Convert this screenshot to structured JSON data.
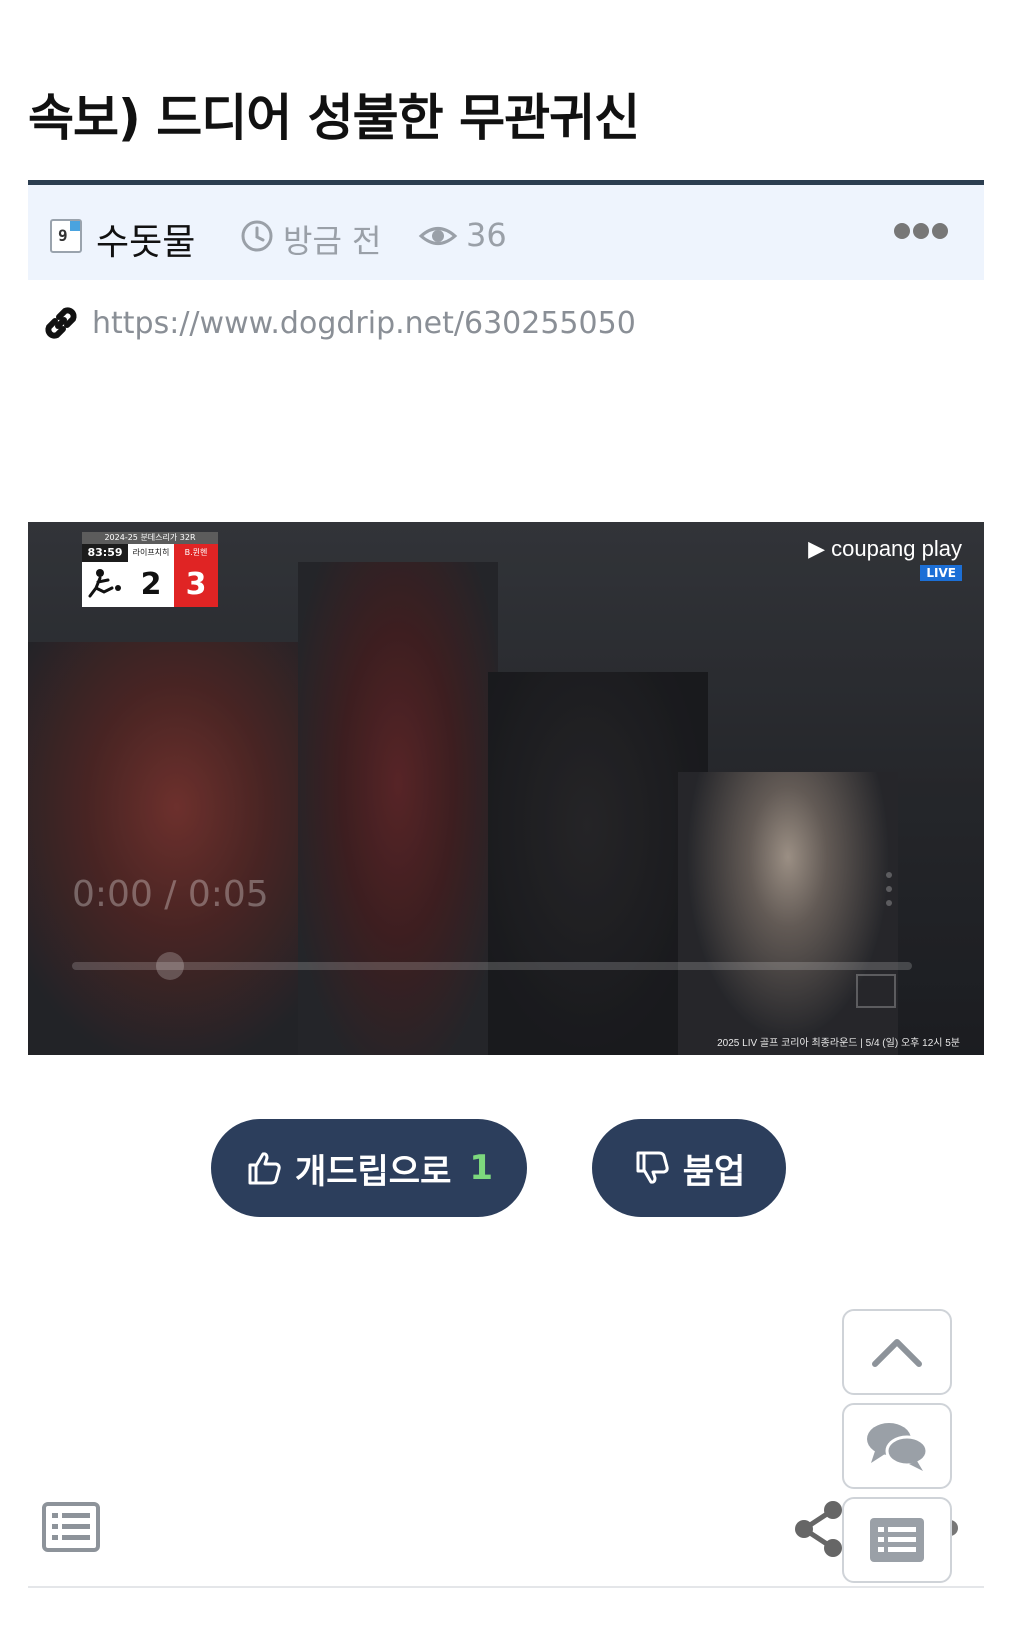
{
  "post": {
    "title": "속보) 드디어 성불한 무관귀신",
    "author": "수돗물",
    "author_badge": "9",
    "time": "방금 전",
    "views": "36",
    "link": "https://www.dogdrip.net/630255050"
  },
  "video": {
    "scoreboard": {
      "league": "2024-25 분데스리가 32R",
      "clock": "83:59",
      "home_team": "라이프치히",
      "away_team": "B.뮌헨",
      "home_score": "2",
      "away_score": "3"
    },
    "brand": "coupang play",
    "live_label": "LIVE",
    "time_display": "0:00 / 0:05",
    "progress": 0.0,
    "ticker": "2025 LIV 골프 코리아 최종라운드 | 5/4 (일) 오후 12시 5분"
  },
  "actions": {
    "upvote_label": "개드립으로",
    "upvote_count": "1",
    "downvote_label": "붐업"
  },
  "icons": {
    "link": "link-icon",
    "clock": "clock-icon",
    "eye": "eye-icon",
    "more": "more-dots-icon",
    "thumbs_up": "thumbs-up-icon",
    "thumbs_down": "thumbs-down-icon",
    "scroll_top": "chevron-up-icon",
    "comments": "comments-icon",
    "list": "list-icon",
    "share": "share-icon"
  },
  "colors": {
    "accent_dark": "#2c3e5c",
    "meta_bg": "#eef4fd",
    "upvote_count": "#7dd87d",
    "live_badge": "#1c6fd6",
    "away_red": "#e02424"
  }
}
